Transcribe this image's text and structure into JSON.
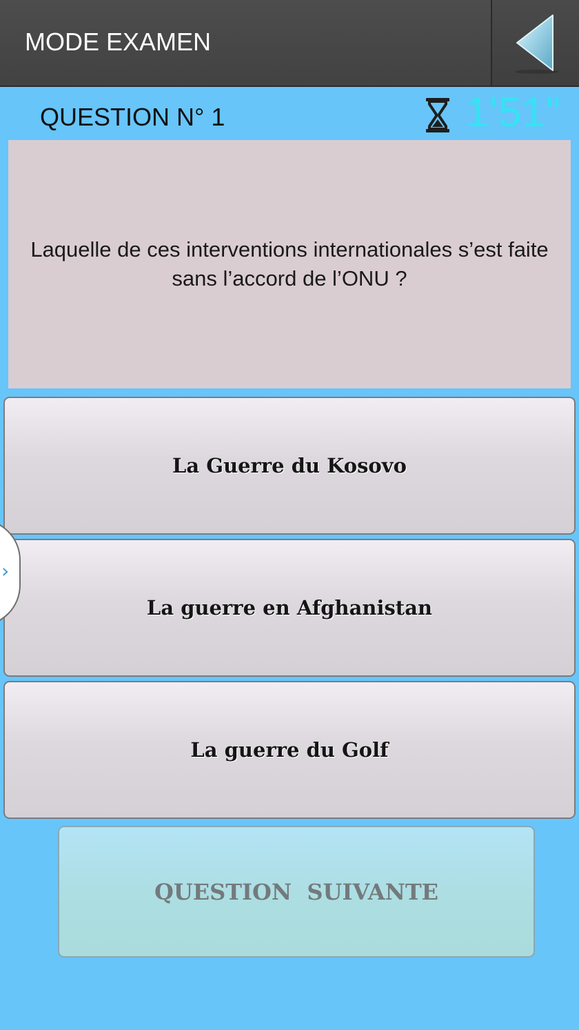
{
  "header": {
    "title": "MODE EXAMEN",
    "back_icon": "back-arrow-icon"
  },
  "status": {
    "question_number": "QUESTION N° 1",
    "timer_icon": "hourglass-icon",
    "timer": "1'51\""
  },
  "question": {
    "text": "Laquelle de ces interventions internationales s’est faite sans l’accord de l’ONU ?"
  },
  "answers": [
    {
      "label": "La Guerre du Kosovo"
    },
    {
      "label": "La guerre en Afghanistan"
    },
    {
      "label": "La guerre du Golf"
    }
  ],
  "drawer": {
    "handle_glyph": "›"
  },
  "next_button": {
    "label": "QUESTION  SUIVANTE"
  },
  "colors": {
    "background": "#67c5fa",
    "header": "#474747",
    "timer": "#35e3f3",
    "question_box": "#dacdd1",
    "next_button": "#acdde0"
  }
}
